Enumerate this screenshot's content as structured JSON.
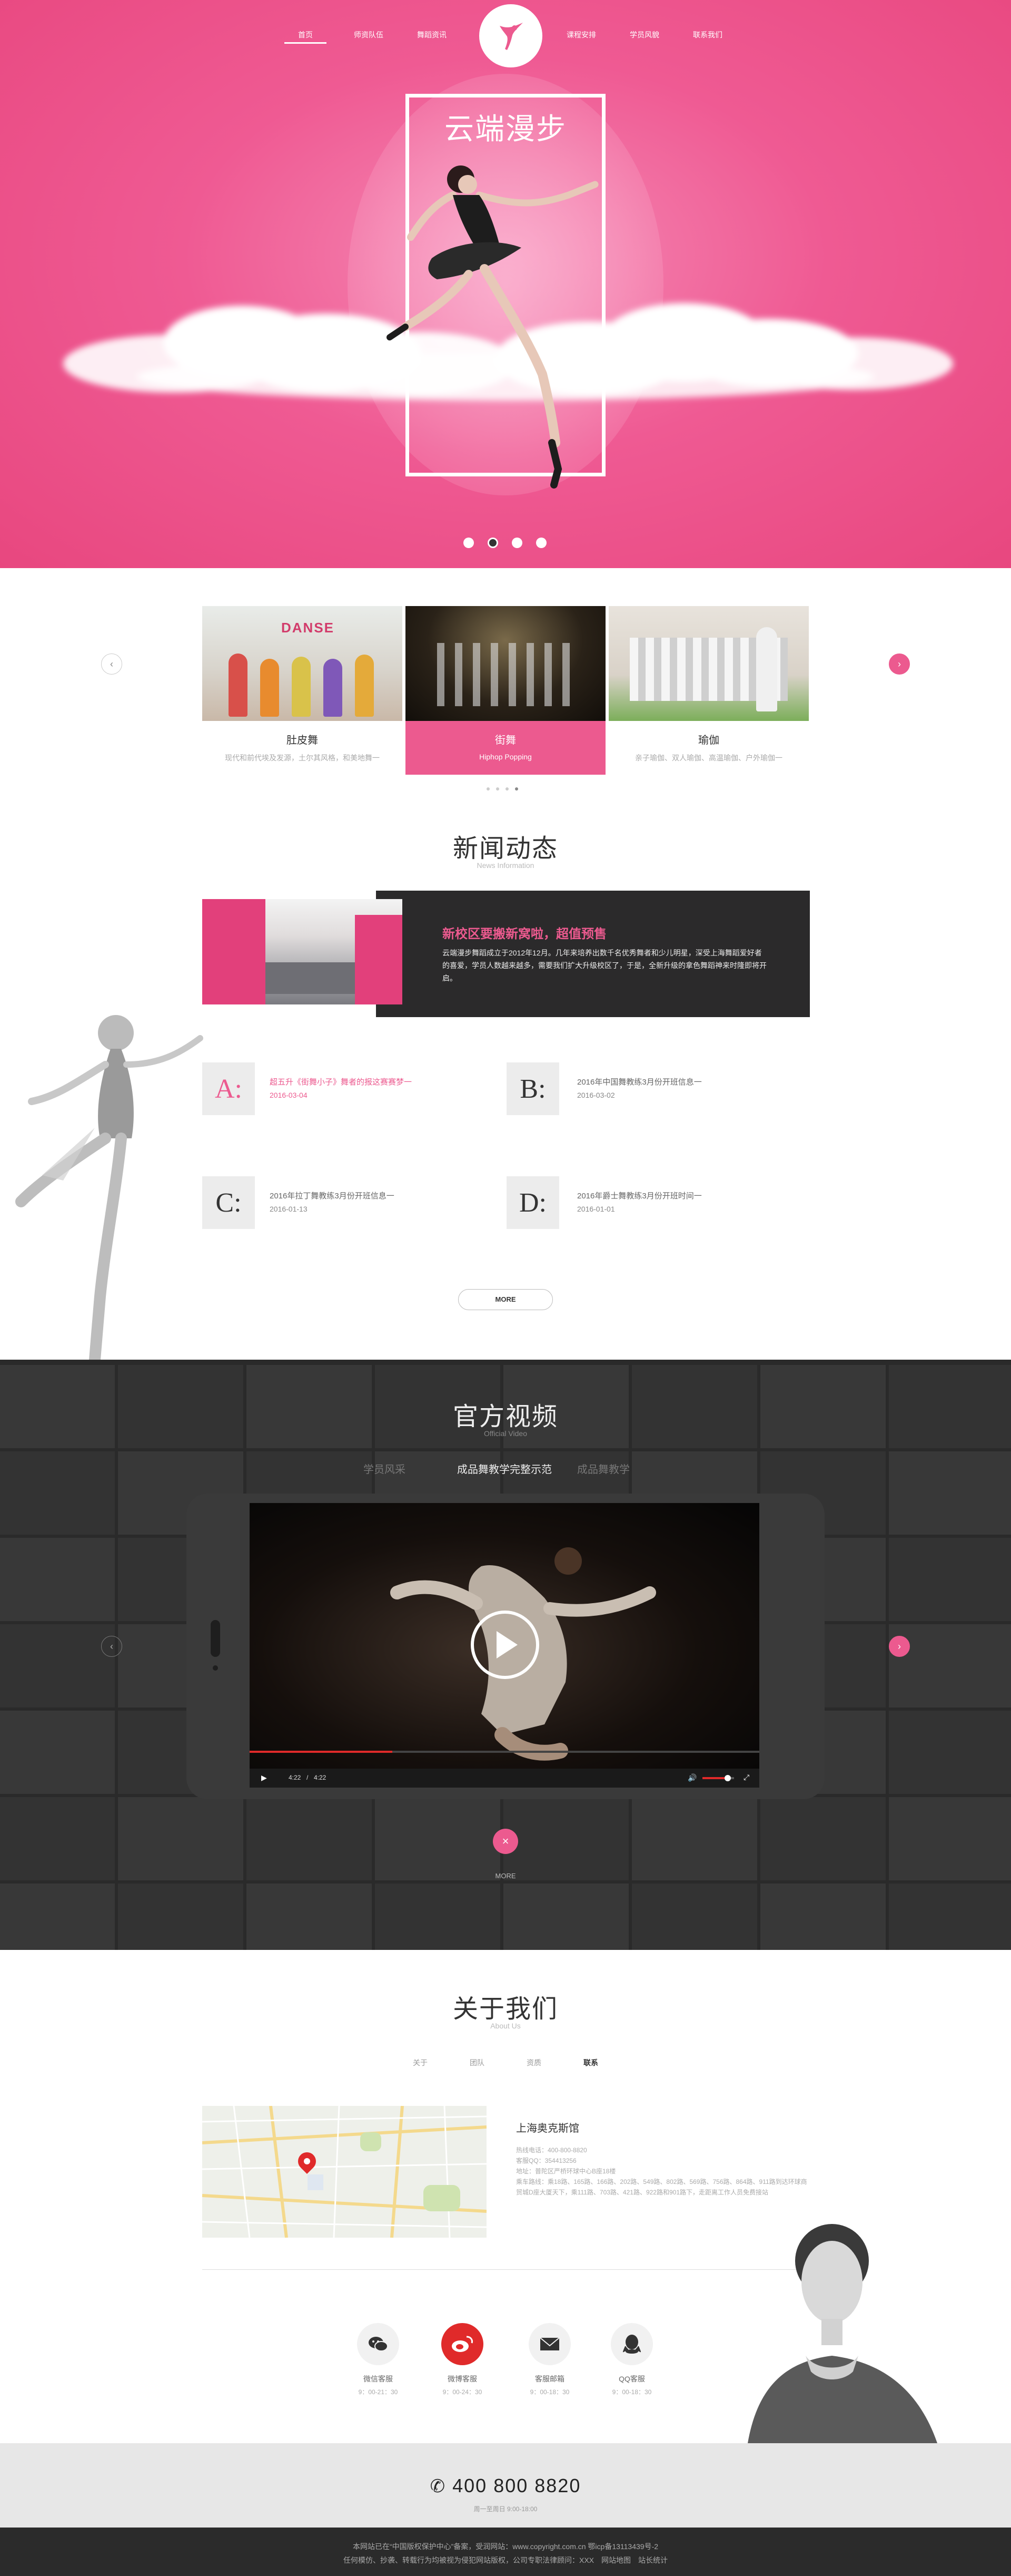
{
  "nav": {
    "items": [
      "首页",
      "师资队伍",
      "舞蹈资讯",
      "课程安排",
      "学员风貌",
      "联系我们"
    ],
    "active": "首页"
  },
  "hero": {
    "title": "云端漫步",
    "slide_count": 4,
    "active_slide": 2
  },
  "courses": [
    {
      "title": "肚皮舞",
      "subtitle": "现代和前代埃及发源，土尔其风格，和美地舞一"
    },
    {
      "title": "街舞",
      "subtitle": "Hiphop Popping"
    },
    {
      "title": "瑜伽",
      "subtitle": "亲子瑜伽、双人瑜伽、高温瑜伽、户外瑜伽一"
    }
  ],
  "news": {
    "title": "新闻动态",
    "subtitle": "News Information",
    "feature": {
      "title": "新校区要搬新窝啦，超值预售",
      "text": "云端漫步舞蹈成立于2012年12月。几年来培养出数千名优秀舞者和少儿明星，深受上海舞蹈爱好者的喜爱，学员人数越来越多，需要我们扩大升级校区了，于是，全新升级的拿色舞蹈神来时隆即将开启。"
    },
    "items": [
      {
        "letter": "A:",
        "title": "超五升《街舞小子》舞者的报这赛赛梦一",
        "date": "2016-03-04"
      },
      {
        "letter": "B:",
        "title": "2016年中国舞教练3月份开班信息一",
        "date": "2016-03-02"
      },
      {
        "letter": "C:",
        "title": "2016年拉丁舞教练3月份开班信息一",
        "date": "2016-01-13"
      },
      {
        "letter": "D:",
        "title": "2016年爵士舞教练3月份开班时间一",
        "date": "2016-01-01"
      }
    ],
    "more": "MORE"
  },
  "video": {
    "title": "官方视频",
    "subtitle": "Official Video",
    "tabs": [
      "学员风采",
      "成品舞教学完整示范",
      "成品舞教学"
    ],
    "active_tab": 1,
    "time_current": "4:22",
    "time_total": "4:22",
    "progress": 0.28,
    "volume": 0.8,
    "more": "MORE"
  },
  "about": {
    "title": "关于我们",
    "subtitle": "About Us",
    "tabs": [
      "关于",
      "团队",
      "资质",
      "联系"
    ],
    "active_tab": 3,
    "name": "上海奥克斯馆",
    "info": "热线电话：400-800-8820\n客服QQ：354413256\n地址：普陀区严桥环球中心B座18楼\n乘车路线：乘18路、165路、166路、202路、549路、802路、569路、756路、864路、911路到达环球商贸城D座大厦天下，乘111路、703路、421路、922路和901路下，走距离工作人员免费接站"
  },
  "contacts": [
    {
      "icon": "wechat-icon",
      "label": "微信客服",
      "hours": "9：00-21：30"
    },
    {
      "icon": "weibo-icon",
      "label": "微博客服",
      "hours": "9：00-24：30"
    },
    {
      "icon": "mail-icon",
      "label": "客服邮箱",
      "hours": "9：00-18：30"
    },
    {
      "icon": "qq-icon",
      "label": "QQ客服",
      "hours": "9：00-18：30"
    }
  ],
  "footer": {
    "hotline": "400 800 8820",
    "hotline_sub": "周一至周日 9:00-18:00",
    "line1": "本网站已在“中国版权保护中心”备案，受润网站：www.copyright.com.cn 鄂icp备13113439号-2",
    "line2": "任何模仿、抄袭、转载行为均被视为侵犯网站版权，公司专职法律顾问：XXX　网站地图　站长统计"
  },
  "colors": {
    "accent": "#ec5a8f",
    "dark": "#2b2a2b"
  }
}
